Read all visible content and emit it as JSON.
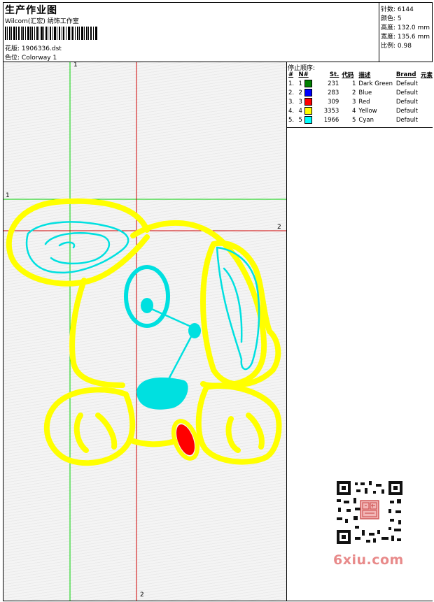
{
  "header": {
    "title": "生产作业图",
    "subtitle": "Wilcom(汇宏) 绣饰工作室",
    "design_label": "花版:",
    "design_value": "1906336.dst",
    "colorway_label": "色位:",
    "colorway_value": "Colorway 1"
  },
  "stats": {
    "stitches": "针数: 6144",
    "colors": "颜色: 5",
    "height": "高度: 132.0 mm",
    "width": "宽度: 135.6 mm",
    "scale": "比例: 0.98"
  },
  "color_order": {
    "title": "停止顺序:",
    "headers": [
      "#",
      "N#",
      "St.",
      "代码",
      "描述",
      "Brand",
      "元素"
    ],
    "rows": [
      {
        "idx": "1.",
        "n": "1",
        "color": "#008000",
        "stitches": "231",
        "code": "1",
        "desc": "Dark Green",
        "brand": "Default"
      },
      {
        "idx": "2.",
        "n": "2",
        "color": "#0000ff",
        "stitches": "283",
        "code": "2",
        "desc": "Blue",
        "brand": "Default"
      },
      {
        "idx": "3.",
        "n": "3",
        "color": "#ff0000",
        "stitches": "309",
        "code": "3",
        "desc": "Red",
        "brand": "Default"
      },
      {
        "idx": "4.",
        "n": "4",
        "color": "#ffff00",
        "stitches": "3353",
        "code": "4",
        "desc": "Yellow",
        "brand": "Default"
      },
      {
        "idx": "5.",
        "n": "5",
        "color": "#00ffff",
        "stitches": "1966",
        "code": "5",
        "desc": "Cyan",
        "brand": "Default"
      }
    ]
  },
  "guides": {
    "vertical_green": "1",
    "horizontal_green": "1",
    "horizontal_red": "2",
    "vertical_red": "2"
  },
  "watermark": "6xiu.com",
  "qr_stamp": "设计图"
}
